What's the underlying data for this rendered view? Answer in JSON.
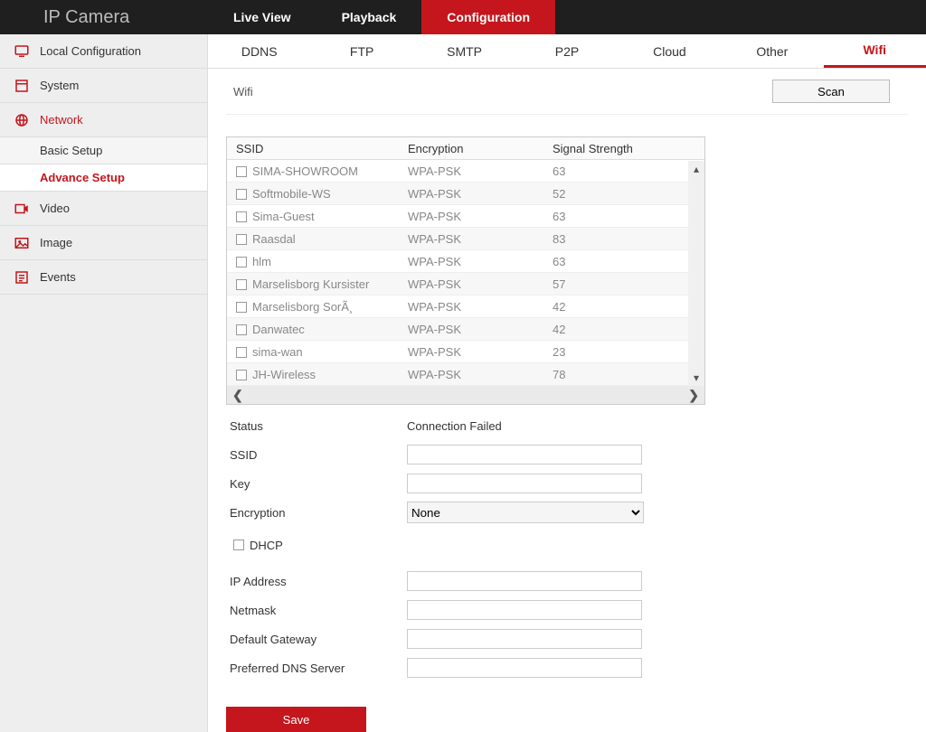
{
  "brand": "IP Camera",
  "topnav": {
    "live": "Live View",
    "playback": "Playback",
    "config": "Configuration"
  },
  "sidebar": {
    "local": "Local Configuration",
    "system": "System",
    "network": "Network",
    "basic": "Basic Setup",
    "advance": "Advance Setup",
    "video": "Video",
    "image": "Image",
    "events": "Events"
  },
  "subtabs": {
    "ddns": "DDNS",
    "ftp": "FTP",
    "smtp": "SMTP",
    "p2p": "P2P",
    "cloud": "Cloud",
    "other": "Other",
    "wifi": "Wifi"
  },
  "wifi": {
    "panel_label": "Wifi",
    "scan": "Scan",
    "columns": {
      "ssid": "SSID",
      "enc": "Encryption",
      "sig": "Signal Strength"
    },
    "rows": [
      {
        "ssid": "SIMA-SHOWROOM",
        "enc": "WPA-PSK",
        "sig": "63"
      },
      {
        "ssid": "Softmobile-WS",
        "enc": "WPA-PSK",
        "sig": "52"
      },
      {
        "ssid": "Sima-Guest",
        "enc": "WPA-PSK",
        "sig": "63"
      },
      {
        "ssid": "Raasdal",
        "enc": "WPA-PSK",
        "sig": "83"
      },
      {
        "ssid": "hlm",
        "enc": "WPA-PSK",
        "sig": "63"
      },
      {
        "ssid": "Marselisborg Kursister",
        "enc": "WPA-PSK",
        "sig": "57"
      },
      {
        "ssid": "Marselisborg SorÃ¸",
        "enc": "WPA-PSK",
        "sig": "42"
      },
      {
        "ssid": "Danwatec",
        "enc": "WPA-PSK",
        "sig": "42"
      },
      {
        "ssid": "sima-wan",
        "enc": "WPA-PSK",
        "sig": "23"
      },
      {
        "ssid": "JH-Wireless",
        "enc": "WPA-PSK",
        "sig": "78"
      }
    ],
    "status_label": "Status",
    "status_value": "Connection Failed",
    "form": {
      "ssid": "SSID",
      "key": "Key",
      "encryption": "Encryption",
      "encryption_value": "None",
      "dhcp": "DHCP",
      "ip": "IP Address",
      "netmask": "Netmask",
      "gateway": "Default Gateway",
      "dns": "Preferred DNS Server"
    },
    "save": "Save"
  }
}
